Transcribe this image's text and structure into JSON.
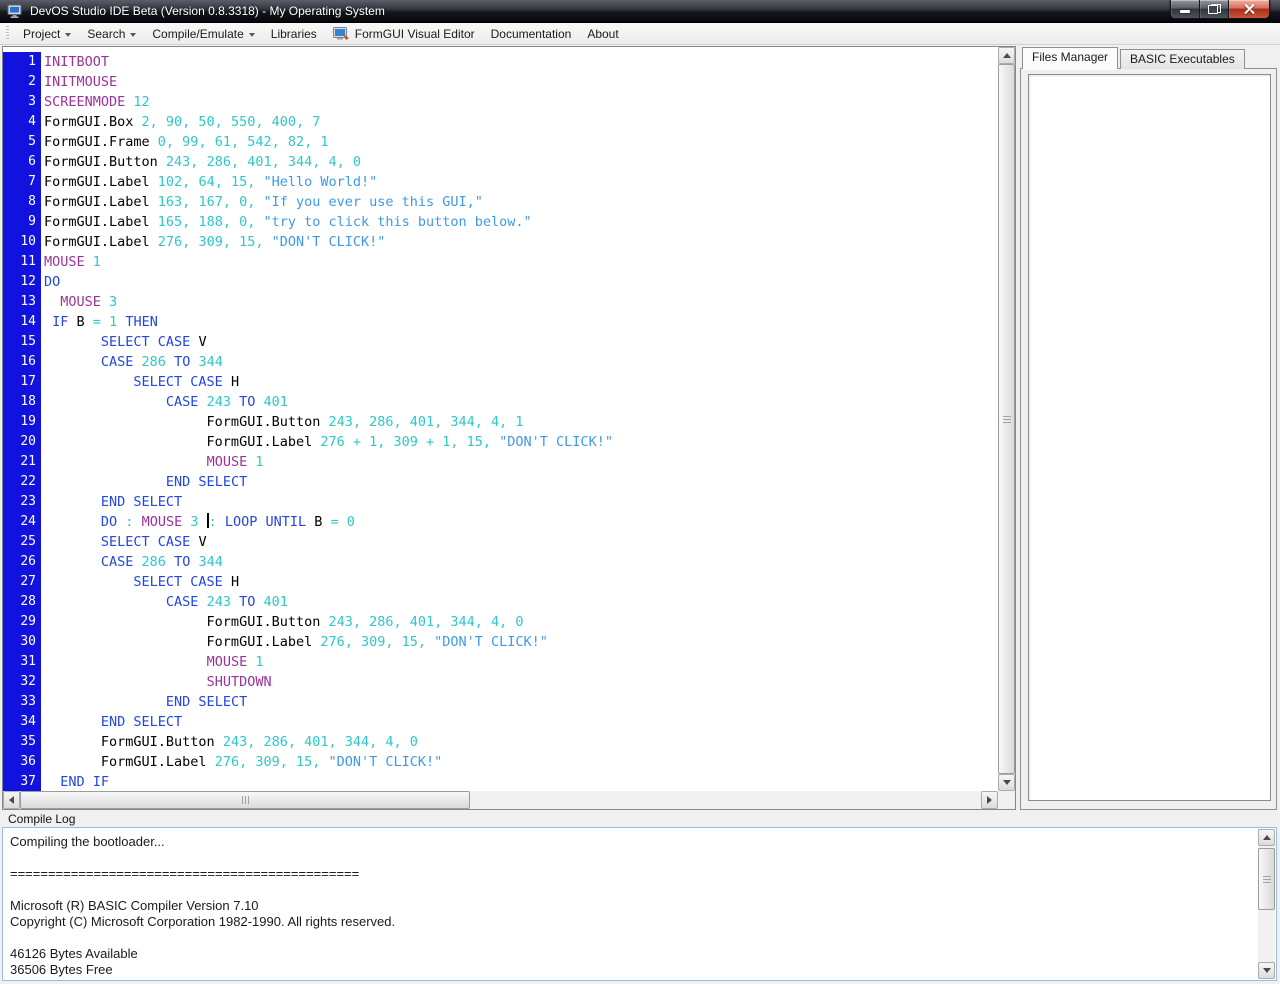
{
  "window": {
    "title": "DevOS Studio IDE Beta (Version 0.8.3318) - My Operating System"
  },
  "menu": {
    "items": [
      {
        "label": "Project",
        "arrow": true
      },
      {
        "label": "Search",
        "arrow": true
      },
      {
        "label": "Compile/Emulate",
        "arrow": true
      },
      {
        "label": "Libraries",
        "arrow": false
      },
      {
        "label": "FormGUI Visual Editor",
        "arrow": false,
        "icon": "formgui-editor-icon"
      },
      {
        "label": "Documentation",
        "arrow": false
      },
      {
        "label": "About",
        "arrow": false
      }
    ]
  },
  "editor": {
    "lines": [
      {
        "no": 1,
        "tokens": [
          [
            "cmd",
            "INITBOOT"
          ]
        ]
      },
      {
        "no": 2,
        "tokens": [
          [
            "cmd",
            "INITMOUSE"
          ]
        ]
      },
      {
        "no": 3,
        "tokens": [
          [
            "cmd",
            "SCREENMODE"
          ],
          [
            "num",
            " 12"
          ]
        ]
      },
      {
        "no": 4,
        "tokens": [
          [
            "txt",
            "FormGUI.Box"
          ],
          [
            "num",
            " 2, 90, 50, 550, 400, 7"
          ]
        ]
      },
      {
        "no": 5,
        "tokens": [
          [
            "txt",
            "FormGUI.Frame"
          ],
          [
            "num",
            " 0, 99, 61, 542, 82, 1"
          ]
        ]
      },
      {
        "no": 6,
        "tokens": [
          [
            "txt",
            "FormGUI.Button"
          ],
          [
            "num",
            " 243, 286, 401, 344, 4, 0"
          ]
        ]
      },
      {
        "no": 7,
        "tokens": [
          [
            "txt",
            "FormGUI.Label"
          ],
          [
            "num",
            " 102, 64, 15,"
          ],
          [
            "str",
            " \"Hello World!\""
          ]
        ]
      },
      {
        "no": 8,
        "tokens": [
          [
            "txt",
            "FormGUI.Label"
          ],
          [
            "num",
            " 163, 167, 0,"
          ],
          [
            "str",
            " \"If you ever use this GUI,\""
          ]
        ]
      },
      {
        "no": 9,
        "tokens": [
          [
            "txt",
            "FormGUI.Label"
          ],
          [
            "num",
            " 165, 188, 0,"
          ],
          [
            "str",
            " \"try to click this button below.\""
          ]
        ]
      },
      {
        "no": 10,
        "tokens": [
          [
            "txt",
            "FormGUI.Label"
          ],
          [
            "num",
            " 276, 309, 15,"
          ],
          [
            "str",
            " \"DON'T CLICK!\""
          ]
        ]
      },
      {
        "no": 11,
        "tokens": [
          [
            "cmd",
            "MOUSE"
          ],
          [
            "num",
            " 1"
          ]
        ]
      },
      {
        "no": 12,
        "tokens": [
          [
            "kw",
            "DO"
          ]
        ]
      },
      {
        "no": 13,
        "tokens": [
          [
            "txt",
            "  "
          ],
          [
            "cmd",
            "MOUSE"
          ],
          [
            "num",
            " 3"
          ]
        ]
      },
      {
        "no": 14,
        "tokens": [
          [
            "txt",
            " "
          ],
          [
            "kw",
            "IF"
          ],
          [
            "txt",
            " B "
          ],
          [
            "op",
            "="
          ],
          [
            "num",
            " 1 "
          ],
          [
            "kw",
            "THEN"
          ]
        ]
      },
      {
        "no": 15,
        "tokens": [
          [
            "txt",
            "       "
          ],
          [
            "kw",
            "SELECT CASE"
          ],
          [
            "txt",
            " V"
          ]
        ]
      },
      {
        "no": 16,
        "tokens": [
          [
            "txt",
            "       "
          ],
          [
            "kw",
            "CASE"
          ],
          [
            "num",
            " 286 "
          ],
          [
            "kw",
            "TO"
          ],
          [
            "num",
            " 344"
          ]
        ]
      },
      {
        "no": 17,
        "tokens": [
          [
            "txt",
            "           "
          ],
          [
            "kw",
            "SELECT CASE"
          ],
          [
            "txt",
            " H"
          ]
        ]
      },
      {
        "no": 18,
        "tokens": [
          [
            "txt",
            "               "
          ],
          [
            "kw",
            "CASE"
          ],
          [
            "num",
            " 243 "
          ],
          [
            "kw",
            "TO"
          ],
          [
            "num",
            " 401"
          ]
        ]
      },
      {
        "no": 19,
        "tokens": [
          [
            "txt",
            "                    FormGUI.Button"
          ],
          [
            "num",
            " 243, 286, 401, 344, 4, 1"
          ]
        ]
      },
      {
        "no": 20,
        "tokens": [
          [
            "txt",
            "                    FormGUI.Label"
          ],
          [
            "num",
            " 276 + 1, 309 + 1, 15,"
          ],
          [
            "str",
            " \"DON'T CLICK!\""
          ]
        ]
      },
      {
        "no": 21,
        "tokens": [
          [
            "txt",
            "                    "
          ],
          [
            "cmd",
            "MOUSE"
          ],
          [
            "num",
            " 1"
          ]
        ]
      },
      {
        "no": 22,
        "tokens": [
          [
            "txt",
            "               "
          ],
          [
            "kw",
            "END SELECT"
          ]
        ]
      },
      {
        "no": 23,
        "tokens": [
          [
            "txt",
            "       "
          ],
          [
            "kw",
            "END SELECT"
          ]
        ]
      },
      {
        "no": 24,
        "tokens": [
          [
            "txt",
            "       "
          ],
          [
            "kw",
            "DO"
          ],
          [
            "op",
            " : "
          ],
          [
            "cmd",
            "MOUSE"
          ],
          [
            "num",
            " 3 "
          ],
          [
            "caret",
            ""
          ],
          [
            "op",
            ": "
          ],
          [
            "kw",
            "LOOP UNTIL"
          ],
          [
            "txt",
            " B "
          ],
          [
            "op",
            "="
          ],
          [
            "num",
            " 0"
          ]
        ]
      },
      {
        "no": 25,
        "tokens": [
          [
            "txt",
            "       "
          ],
          [
            "kw",
            "SELECT CASE"
          ],
          [
            "txt",
            " V"
          ]
        ]
      },
      {
        "no": 26,
        "tokens": [
          [
            "txt",
            "       "
          ],
          [
            "kw",
            "CASE"
          ],
          [
            "num",
            " 286 "
          ],
          [
            "kw",
            "TO"
          ],
          [
            "num",
            " 344"
          ]
        ]
      },
      {
        "no": 27,
        "tokens": [
          [
            "txt",
            "           "
          ],
          [
            "kw",
            "SELECT CASE"
          ],
          [
            "txt",
            " H"
          ]
        ]
      },
      {
        "no": 28,
        "tokens": [
          [
            "txt",
            "               "
          ],
          [
            "kw",
            "CASE"
          ],
          [
            "num",
            " 243 "
          ],
          [
            "kw",
            "TO"
          ],
          [
            "num",
            " 401"
          ]
        ]
      },
      {
        "no": 29,
        "tokens": [
          [
            "txt",
            "                    FormGUI.Button"
          ],
          [
            "num",
            " 243, 286, 401, 344, 4, 0"
          ]
        ]
      },
      {
        "no": 30,
        "tokens": [
          [
            "txt",
            "                    FormGUI.Label"
          ],
          [
            "num",
            " 276, 309, 15,"
          ],
          [
            "str",
            " \"DON'T CLICK!\""
          ]
        ]
      },
      {
        "no": 31,
        "tokens": [
          [
            "txt",
            "                    "
          ],
          [
            "cmd",
            "MOUSE"
          ],
          [
            "num",
            " 1"
          ]
        ]
      },
      {
        "no": 32,
        "tokens": [
          [
            "txt",
            "                    "
          ],
          [
            "cmd",
            "SHUTDOWN"
          ]
        ]
      },
      {
        "no": 33,
        "tokens": [
          [
            "txt",
            "               "
          ],
          [
            "kw",
            "END SELECT"
          ]
        ]
      },
      {
        "no": 34,
        "tokens": [
          [
            "txt",
            "       "
          ],
          [
            "kw",
            "END SELECT"
          ]
        ]
      },
      {
        "no": 35,
        "tokens": [
          [
            "txt",
            "       FormGUI.Button"
          ],
          [
            "num",
            " 243, 286, 401, 344, 4, 0"
          ]
        ]
      },
      {
        "no": 36,
        "tokens": [
          [
            "txt",
            "       FormGUI.Label"
          ],
          [
            "num",
            " 276, 309, 15,"
          ],
          [
            "str",
            " \"DON'T CLICK!\""
          ]
        ]
      },
      {
        "no": 37,
        "tokens": [
          [
            "txt",
            "  "
          ],
          [
            "kw",
            "END IF"
          ]
        ]
      }
    ]
  },
  "right_panel": {
    "tabs": [
      {
        "label": "Files Manager",
        "active": true
      },
      {
        "label": "BASIC Executables",
        "active": false
      }
    ]
  },
  "compile_log": {
    "label": "Compile Log",
    "lines": [
      "Compiling the bootloader...",
      "",
      "==============================================",
      "",
      "Microsoft (R) BASIC Compiler Version 7.10",
      "Copyright (C) Microsoft Corporation 1982-1990. All rights reserved.",
      "",
      "46126 Bytes Available",
      "36506 Bytes Free"
    ]
  },
  "colors": {
    "keyword": "#2346E0",
    "command": "#993399",
    "number": "#2FC7C7",
    "operator": "#2FC7C7",
    "string": "#3E9AE8",
    "identifier": "#000000",
    "gutter_bg": "#1212DF",
    "gutter_text": "#FFFFFF",
    "close_button": "#B03826",
    "log_border": "#94BEE5"
  }
}
